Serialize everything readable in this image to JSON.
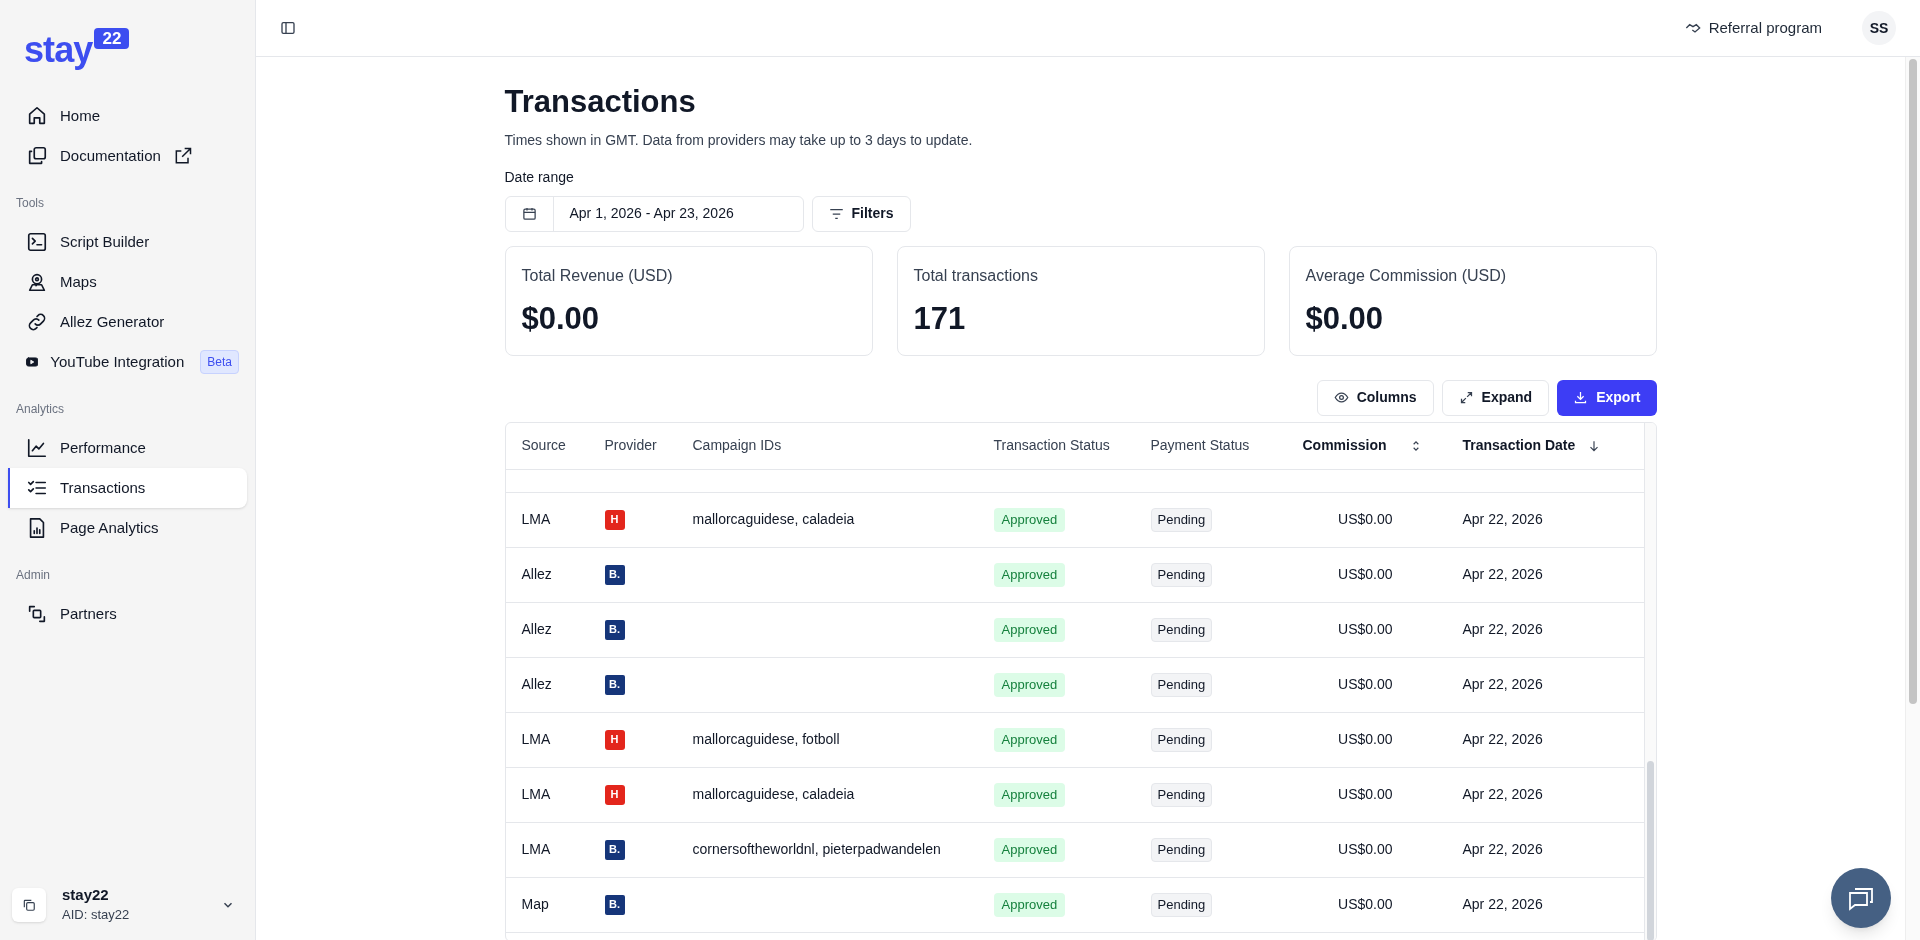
{
  "sidebar": {
    "logo": {
      "word": "stay",
      "badge": "22"
    },
    "sections": [
      {
        "items": [
          {
            "label": "Home",
            "selected": false,
            "external": false
          },
          {
            "label": "Documentation",
            "selected": false,
            "external": true
          }
        ]
      },
      {
        "title": "Tools",
        "items": [
          {
            "label": "Script Builder",
            "selected": false,
            "external": false
          },
          {
            "label": "Maps",
            "selected": false,
            "external": false
          },
          {
            "label": "Allez Generator",
            "selected": false,
            "external": false
          },
          {
            "label": "YouTube Integration",
            "selected": false,
            "external": false,
            "badge": "Beta"
          }
        ]
      },
      {
        "title": "Analytics",
        "items": [
          {
            "label": "Performance",
            "selected": false,
            "external": false
          },
          {
            "label": "Transactions",
            "selected": true,
            "external": false
          },
          {
            "label": "Page Analytics",
            "selected": false,
            "external": false
          }
        ]
      },
      {
        "title": "Admin",
        "items": [
          {
            "label": "Partners",
            "selected": false,
            "external": false
          }
        ]
      }
    ],
    "account": {
      "name": "stay22",
      "aid": "AID: stay22"
    }
  },
  "header": {
    "referral": "Referral program",
    "avatar": "SS"
  },
  "page": {
    "title": "Transactions",
    "subtitle": "Times shown in GMT. Data from providers may take up to 3 days to update.",
    "date_label": "Date range",
    "date_value": "Apr 1, 2026 - Apr 23, 2026",
    "filters": "Filters"
  },
  "stats": [
    {
      "label": "Total Revenue (USD)",
      "value": "$0.00"
    },
    {
      "label": "Total transactions",
      "value": "171"
    },
    {
      "label": "Average Commission (USD)",
      "value": "$0.00"
    }
  ],
  "actions": [
    {
      "label": "Columns",
      "kind": "outline"
    },
    {
      "label": "Expand",
      "kind": "outline"
    },
    {
      "label": "Export",
      "kind": "primary"
    }
  ],
  "table": {
    "columns": [
      {
        "label": "Source",
        "sortable": false
      },
      {
        "label": "Provider",
        "sortable": false
      },
      {
        "label": "Campaign IDs",
        "sortable": false
      },
      {
        "label": "Transaction Status",
        "sortable": false
      },
      {
        "label": "Payment Status",
        "sortable": false
      },
      {
        "label": "Commission",
        "sortable": true
      },
      {
        "label": "Transaction Date",
        "sortable": true,
        "sorted_descending": true
      }
    ],
    "rows": [
      {
        "source": "LMA",
        "provider": {
          "kind": "hotels",
          "mark": "H"
        },
        "campaign_ids": "mallorcaguidese, caladeia",
        "transaction_status": "Approved",
        "payment_status": "Pending",
        "commission": "US$0.00",
        "date": "Apr 22, 2026"
      },
      {
        "source": "Allez",
        "provider": {
          "kind": "booking",
          "mark": "B."
        },
        "campaign_ids": "",
        "transaction_status": "Approved",
        "payment_status": "Pending",
        "commission": "US$0.00",
        "date": "Apr 22, 2026"
      },
      {
        "source": "Allez",
        "provider": {
          "kind": "booking",
          "mark": "B."
        },
        "campaign_ids": "",
        "transaction_status": "Approved",
        "payment_status": "Pending",
        "commission": "US$0.00",
        "date": "Apr 22, 2026"
      },
      {
        "source": "Allez",
        "provider": {
          "kind": "booking",
          "mark": "B."
        },
        "campaign_ids": "",
        "transaction_status": "Approved",
        "payment_status": "Pending",
        "commission": "US$0.00",
        "date": "Apr 22, 2026"
      },
      {
        "source": "LMA",
        "provider": {
          "kind": "hotels",
          "mark": "H"
        },
        "campaign_ids": "mallorcaguidese, fotboll",
        "transaction_status": "Approved",
        "payment_status": "Pending",
        "commission": "US$0.00",
        "date": "Apr 22, 2026"
      },
      {
        "source": "LMA",
        "provider": {
          "kind": "hotels",
          "mark": "H"
        },
        "campaign_ids": "mallorcaguidese, caladeia",
        "transaction_status": "Approved",
        "payment_status": "Pending",
        "commission": "US$0.00",
        "date": "Apr 22, 2026"
      },
      {
        "source": "LMA",
        "provider": {
          "kind": "booking",
          "mark": "B."
        },
        "campaign_ids": "cornersoftheworldnl, pieterpadwandelen",
        "transaction_status": "Approved",
        "payment_status": "Pending",
        "commission": "US$0.00",
        "date": "Apr 22, 2026"
      },
      {
        "source": "Map",
        "provider": {
          "kind": "booking",
          "mark": "B."
        },
        "campaign_ids": "",
        "transaction_status": "Approved",
        "payment_status": "Pending",
        "commission": "US$0.00",
        "date": "Apr 22, 2026"
      }
    ]
  }
}
